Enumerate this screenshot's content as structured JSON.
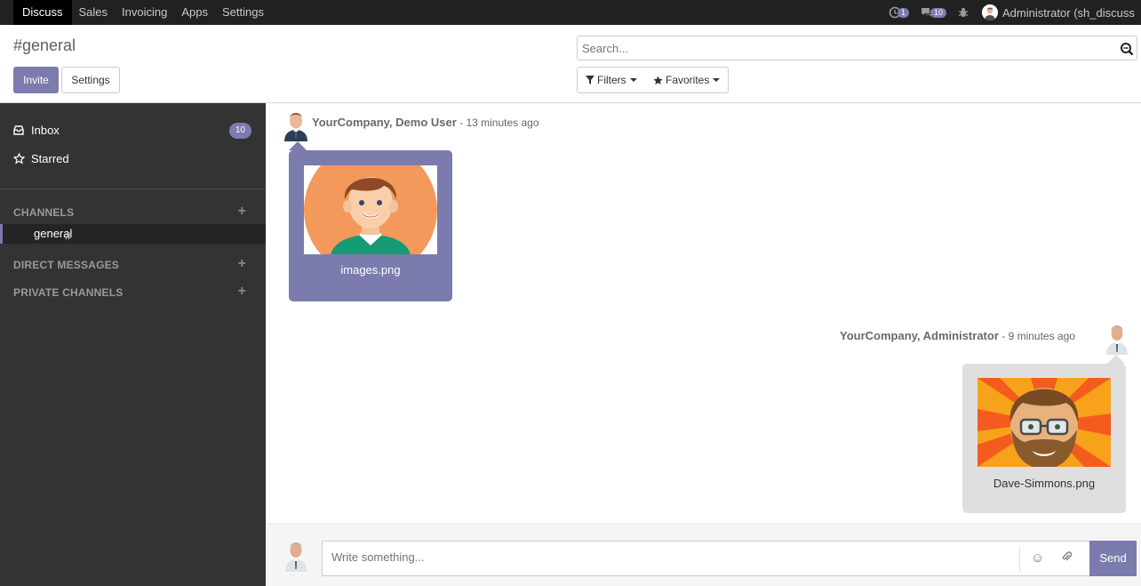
{
  "topnav": {
    "menu": [
      "Discuss",
      "Sales",
      "Invoicing",
      "Apps",
      "Settings"
    ],
    "activity_count": "1",
    "messages_count": "10",
    "user_label": "Administrator (sh_discuss"
  },
  "control": {
    "title": "#general",
    "invite_label": "Invite",
    "settings_label": "Settings",
    "search_placeholder": "Search...",
    "filters_label": "Filters",
    "favorites_label": "Favorites"
  },
  "sidebar": {
    "inbox_label": "Inbox",
    "inbox_count": "10",
    "starred_label": "Starred",
    "channels_label": "CHANNELS",
    "channel_hash": "#",
    "channel_name": "general",
    "direct_label": "DIRECT MESSAGES",
    "private_label": "PRIVATE CHANNELS"
  },
  "messages": [
    {
      "author": "YourCompany, Demo User",
      "time": "- 13 minutes ago",
      "attachment": "images.png"
    },
    {
      "author": "YourCompany, Administrator",
      "time": "- 9 minutes ago",
      "attachment": "Dave-Simmons.png"
    }
  ],
  "composer": {
    "placeholder": "Write something...",
    "send_label": "Send"
  },
  "colors": {
    "accent": "#7c7bad",
    "sidebar_bg": "#333333",
    "topnav_bg": "#212121"
  }
}
